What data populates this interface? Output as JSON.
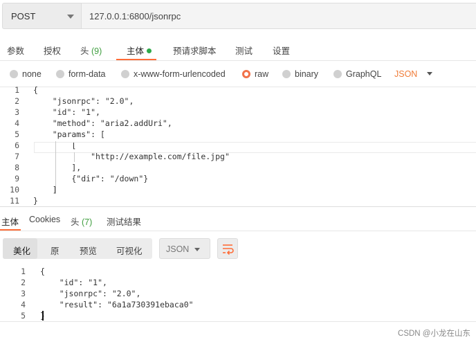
{
  "request": {
    "method": "POST",
    "url": "127.0.0.1:6800/jsonrpc"
  },
  "req_tabs": {
    "params": "参数",
    "auth": "授权",
    "headers": "头",
    "headers_count": "(9)",
    "body": "主体",
    "prerequest": "预请求脚本",
    "tests": "测试",
    "settings": "设置"
  },
  "body_types": {
    "none": "none",
    "form_data": "form-data",
    "urlencoded": "x-www-form-urlencoded",
    "raw": "raw",
    "binary": "binary",
    "graphql": "GraphQL",
    "selected_format": "JSON"
  },
  "request_body": {
    "lines": [
      {
        "n": "1",
        "text": "{"
      },
      {
        "n": "2",
        "text": "    \"jsonrpc\": \"2.0\","
      },
      {
        "n": "3",
        "text": "    \"id\": \"1\","
      },
      {
        "n": "4",
        "text": "    \"method\": \"aria2.addUri\","
      },
      {
        "n": "5",
        "text": "    \"params\": ["
      },
      {
        "n": "6",
        "text": "        ["
      },
      {
        "n": "7",
        "text": "            \"http://example.com/file.jpg\""
      },
      {
        "n": "8",
        "text": "        ],"
      },
      {
        "n": "9",
        "text": "        {\"dir\": \"/down\"}"
      },
      {
        "n": "10",
        "text": "    ]"
      },
      {
        "n": "11",
        "text": "}"
      }
    ]
  },
  "res_tabs": {
    "body": "主体",
    "cookies": "Cookies",
    "headers": "头",
    "headers_count": "(7)",
    "tests": "测试结果"
  },
  "res_toolbar": {
    "pretty": "美化",
    "raw": "原",
    "preview": "预览",
    "visualize": "可视化",
    "format": "JSON"
  },
  "response_body": {
    "lines": [
      {
        "n": "1",
        "text": "{"
      },
      {
        "n": "2",
        "text": "    \"id\": \"1\","
      },
      {
        "n": "3",
        "text": "    \"jsonrpc\": \"2.0\","
      },
      {
        "n": "4",
        "text": "    \"result\": \"6a1a730391ebaca0\""
      },
      {
        "n": "5",
        "text": "}"
      }
    ]
  },
  "watermark": "CSDN @小龙在山东",
  "colors": {
    "accent": "#ff6c37",
    "json_orange": "#f07c38",
    "count_green": "#3f9e3f",
    "active_dot": "#2eaa4a"
  }
}
